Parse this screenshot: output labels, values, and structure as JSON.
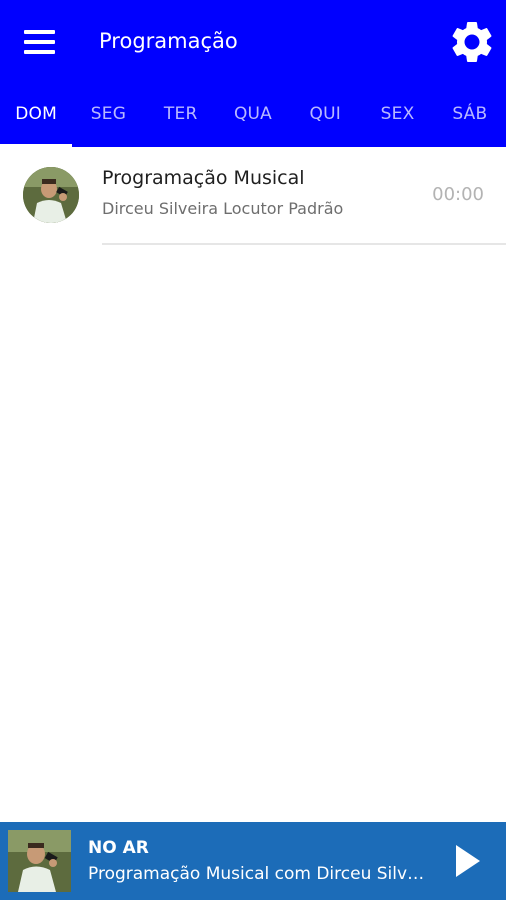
{
  "header": {
    "title": "Programação",
    "background_color": "#0000ff"
  },
  "tabs": [
    {
      "label": "DOM",
      "active": true
    },
    {
      "label": "SEG",
      "active": false
    },
    {
      "label": "TER",
      "active": false
    },
    {
      "label": "QUA",
      "active": false
    },
    {
      "label": "QUI",
      "active": false
    },
    {
      "label": "SEX",
      "active": false
    },
    {
      "label": "SÁB",
      "active": false
    }
  ],
  "schedule": [
    {
      "title": "Programação Musical",
      "subtitle": "Dirceu Silveira Locutor Padrão",
      "time": "00:00",
      "avatar_icon": "host-photo"
    }
  ],
  "player": {
    "label": "NO AR",
    "now_playing": "Programação Musical com Dirceu Silveira Locutor Padrão",
    "background_color": "#1c6cb8",
    "play_icon": "play-icon"
  },
  "icons": {
    "menu": "menu-icon",
    "settings": "gear-icon"
  }
}
